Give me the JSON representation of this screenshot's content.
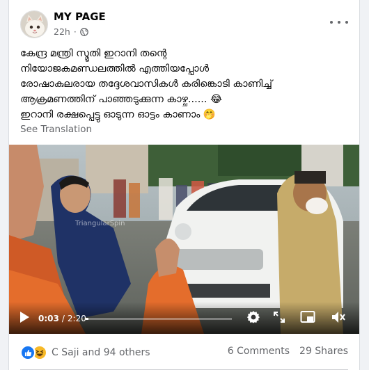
{
  "post": {
    "page_name": "MY PAGE",
    "time_ago": "22h",
    "audience_icon": "globe-icon",
    "menu_icon": "more-horizontal-icon",
    "text_lines": [
      "കേന്ദ്ര മന്ത്രി സ്മൃതി ഇറാനി തന്റെ",
      "നിയോജകമണ്ഡലത്തിൽ എത്തിയപ്പോൾ",
      "രോഷാകുലരായ തദ്ദേശവാസികൾ കരിങ്കൊടി കാണിച്ച്",
      "ആക്രമണത്തിന് പാഞ്ഞടുക്കുന്ന കാഴ്ച...... 😂",
      "ഇറാനി രക്ഷപ്പെട്ടു ഓടുന്ന ഓട്ടം കാണാം 🤭"
    ],
    "see_translation": "See Translation"
  },
  "video": {
    "current_time": "0:03",
    "separator": "/",
    "duration": "2:20",
    "progress_fraction": 0.021,
    "watermark": "TriangularSpin",
    "icons": [
      "play-icon",
      "settings-icon",
      "fullscreen-icon",
      "picture-in-picture-icon",
      "volume-muted-icon"
    ]
  },
  "footer": {
    "reactions_text": "C Saji and 94 others",
    "reaction_icons": [
      "like-icon",
      "haha-icon"
    ],
    "comments": "6 Comments",
    "shares": "29 Shares"
  },
  "colors": {
    "primary_text": "#050505",
    "secondary_text": "#65676b",
    "like_blue": "#1877f2",
    "haha_yellow": "#f7b928",
    "background": "#f0f2f5"
  }
}
